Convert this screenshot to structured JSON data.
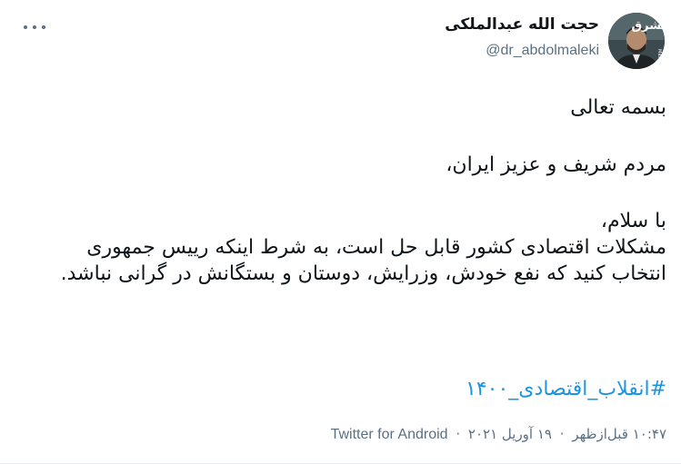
{
  "author": {
    "display_name": "حجت الله عبدالملکی",
    "handle": "@dr_abdolmaleki",
    "avatar_watermark": "Mashreghnews.ir"
  },
  "tweet": {
    "lines": {
      "l1": "بسمه تعالی",
      "l2": "مردم شریف و عزیز ایران،",
      "l3": "با سلام،",
      "l4": "مشکلات اقتصادی کشور قابل حل است، به شرط اینکه رییس جمهوری انتخاب کنید که نفع خودش، وزرایش، دوستان و بستگانش در گرانی نباشد."
    },
    "hashtag": "#انقلاب_اقتصادی_۱۴۰۰"
  },
  "meta": {
    "time": "۱۰:۴۷ قبل‌ازظهر",
    "date": "۱۹ آوریل ۲۰۲۱",
    "source": "Twitter for Android",
    "separator": "·"
  },
  "colors": {
    "link": "#1b95e0",
    "secondary_text": "#5b7083",
    "primary_text": "#0f1419"
  },
  "icons": {
    "more": "more-dots-icon"
  }
}
